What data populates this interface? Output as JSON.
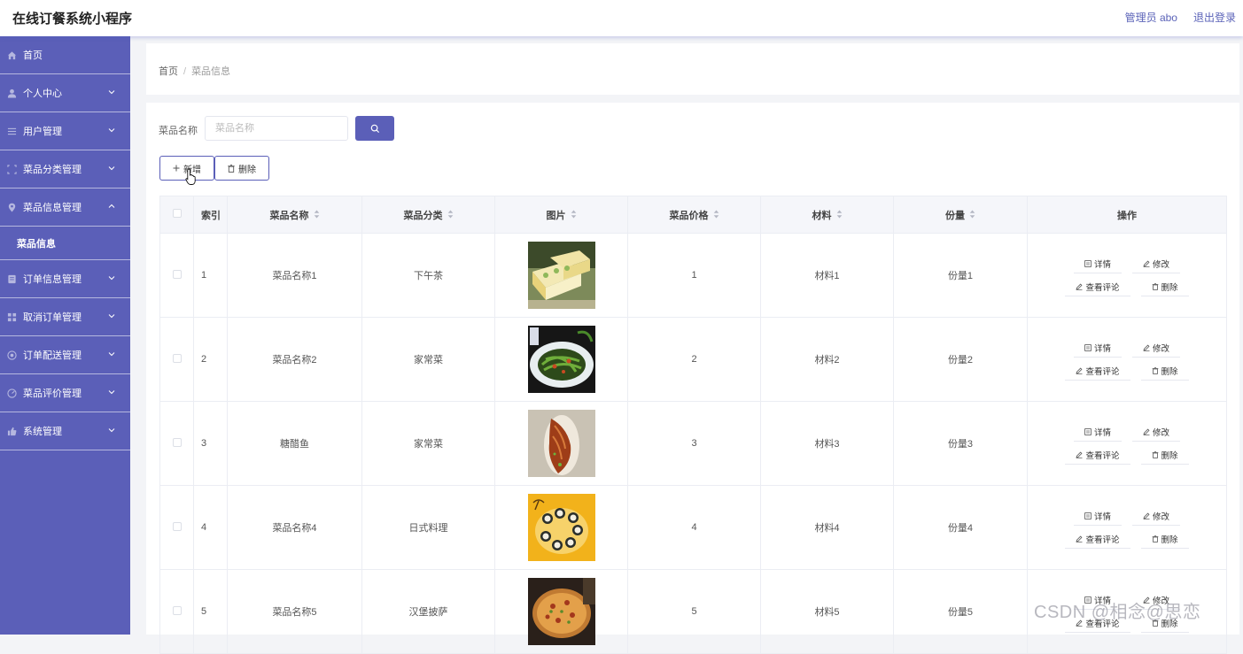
{
  "app": {
    "title": "在线订餐系统小程序"
  },
  "header": {
    "user_label": "管理员 abo",
    "logout_label": "退出登录"
  },
  "sidebar": {
    "items": [
      {
        "label": "首页",
        "icon": "home-icon",
        "has_chevron": false
      },
      {
        "label": "个人中心",
        "icon": "user-icon",
        "has_chevron": true,
        "chevron": "down"
      },
      {
        "label": "用户管理",
        "icon": "menu-icon",
        "has_chevron": true,
        "chevron": "down"
      },
      {
        "label": "菜品分类管理",
        "icon": "crop-icon",
        "has_chevron": true,
        "chevron": "down"
      },
      {
        "label": "菜品信息管理",
        "icon": "location-icon",
        "has_chevron": true,
        "chevron": "up"
      },
      {
        "label": "菜品信息",
        "icon": "",
        "has_chevron": false,
        "sub": true
      },
      {
        "label": "订单信息管理",
        "icon": "document-icon",
        "has_chevron": true,
        "chevron": "down"
      },
      {
        "label": "取消订单管理",
        "icon": "grid-icon",
        "has_chevron": true,
        "chevron": "down"
      },
      {
        "label": "订单配送管理",
        "icon": "truck-icon",
        "has_chevron": true,
        "chevron": "down"
      },
      {
        "label": "菜品评价管理",
        "icon": "star-icon",
        "has_chevron": true,
        "chevron": "down"
      },
      {
        "label": "系统管理",
        "icon": "thumb-icon",
        "has_chevron": true,
        "chevron": "down"
      }
    ]
  },
  "breadcrumb": {
    "home": "首页",
    "separator": "/",
    "current": "菜品信息"
  },
  "search": {
    "label": "菜品名称",
    "placeholder": "菜品名称"
  },
  "toolbar": {
    "add_label": "新增",
    "delete_label": "删除"
  },
  "table": {
    "headers": {
      "index": "索引",
      "name": "菜品名称",
      "category": "菜品分类",
      "image": "图片",
      "price": "菜品价格",
      "material": "材料",
      "portion": "份量",
      "actions": "操作"
    },
    "action_labels": {
      "detail": "详情",
      "edit": "修改",
      "comments": "查看评论",
      "delete": "删除"
    },
    "rows": [
      {
        "index": "1",
        "name": "菜品名称1",
        "category": "下午茶",
        "price": "1",
        "material": "材料1",
        "portion": "份量1",
        "image": "cake"
      },
      {
        "index": "2",
        "name": "菜品名称2",
        "category": "家常菜",
        "price": "2",
        "material": "材料2",
        "portion": "份量2",
        "image": "greens"
      },
      {
        "index": "3",
        "name": "糖醋鱼",
        "category": "家常菜",
        "price": "3",
        "material": "材料3",
        "portion": "份量3",
        "image": "fish"
      },
      {
        "index": "4",
        "name": "菜品名称4",
        "category": "日式料理",
        "price": "4",
        "material": "材料4",
        "portion": "份量4",
        "image": "sushi"
      },
      {
        "index": "5",
        "name": "菜品名称5",
        "category": "汉堡披萨",
        "price": "5",
        "material": "材料5",
        "portion": "份量5",
        "image": "pizza"
      }
    ]
  },
  "watermark": "CSDN @相念@思恋",
  "colors": {
    "accent": "#5b5fb8",
    "sidebar_bg": "#5b5fb8",
    "header_bg": "#f5f6fa"
  }
}
